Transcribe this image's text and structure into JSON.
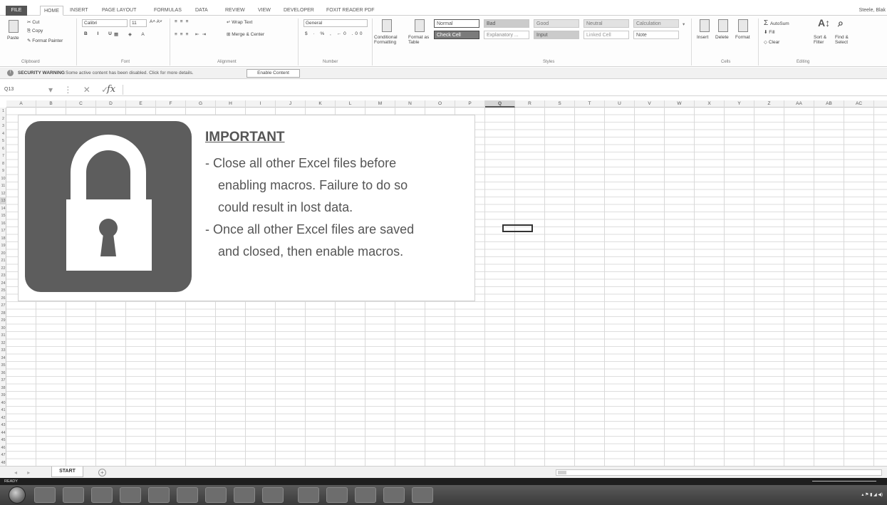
{
  "ribbon_tabs": {
    "file": "FILE",
    "home": "HOME",
    "insert": "INSERT",
    "page_layout": "PAGE LAYOUT",
    "formulas": "FORMULAS",
    "data": "DATA",
    "review": "REVIEW",
    "view": "VIEW",
    "developer": "DEVELOPER",
    "foxit": "FOXIT READER PDF",
    "user": "Steele, Blak"
  },
  "clipboard": {
    "cut": "Cut",
    "copy": "Copy",
    "paste": "Paste",
    "format_painter": "Format Painter",
    "group": "Clipboard"
  },
  "font": {
    "name": "Calibri",
    "size": "11",
    "group": "Font"
  },
  "alignment": {
    "wrap": "Wrap Text",
    "merge": "Merge & Center",
    "group": "Alignment"
  },
  "number": {
    "format": "General",
    "group": "Number"
  },
  "styles": {
    "conditional": "Conditional Formatting",
    "format_table": "Format as Table",
    "normal": "Normal",
    "bad": "Bad",
    "good": "Good",
    "neutral": "Neutral",
    "calculation": "Calculation",
    "check_cell": "Check Cell",
    "explanatory": "Explanatory ...",
    "input": "Input",
    "linked_cell": "Linked Cell",
    "note": "Note",
    "group": "Styles"
  },
  "cells_group": {
    "insert": "Insert",
    "delete": "Delete",
    "format": "Format",
    "group": "Cells"
  },
  "editing": {
    "autosum": "AutoSum",
    "fill": "Fill",
    "clear": "Clear",
    "sort": "Sort & Filter",
    "find": "Find & Select",
    "group": "Editing"
  },
  "security_bar": {
    "title": "SECURITY WARNING",
    "message": "Some active content has been disabled. Click for more details.",
    "button": "Enable Content"
  },
  "formula_bar": {
    "name_box": "Q13",
    "fx": "fx"
  },
  "columns": [
    "A",
    "B",
    "C",
    "D",
    "E",
    "F",
    "G",
    "H",
    "I",
    "J",
    "K",
    "L",
    "M",
    "N",
    "O",
    "P",
    "Q",
    "R",
    "S",
    "T",
    "U",
    "V",
    "W",
    "X",
    "Y",
    "Z",
    "AA",
    "AB",
    "AC"
  ],
  "selected_column": "Q",
  "selected_row": "13",
  "notice": {
    "title": "IMPORTANT",
    "line1": "- Close all other Excel files before",
    "line2": "enabling macros. Failure to do so",
    "line3": "could result in lost data.",
    "line4": "- Once all other Excel files are saved",
    "line5": "and closed, then enable macros."
  },
  "sheet_tabs": {
    "active": "START",
    "add": "+"
  },
  "status": {
    "ready": "READY"
  }
}
